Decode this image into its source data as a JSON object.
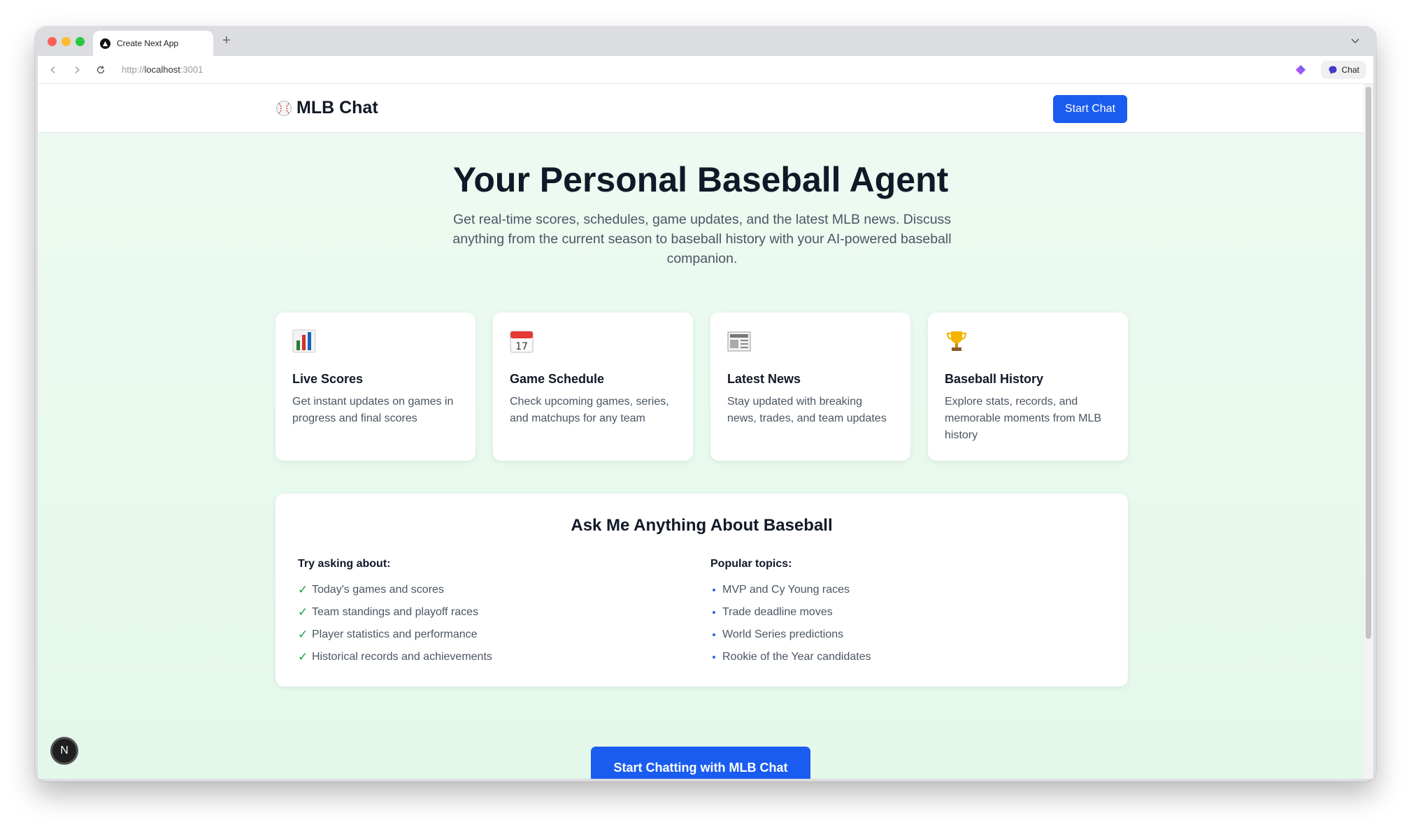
{
  "browser": {
    "tab_title": "Create Next App",
    "new_tab_symbol": "+",
    "url_scheme": "http://",
    "url_host": "localhost",
    "url_port": ":3001",
    "chat_button_label": "Chat"
  },
  "header": {
    "brand_name": "MLB Chat",
    "cta_label": "Start Chat"
  },
  "hero": {
    "title": "Your Personal Baseball Agent",
    "subtitle": "Get real-time scores, schedules, game updates, and the latest MLB news. Discuss anything from the current season to baseball history with your AI-powered baseball companion."
  },
  "features": [
    {
      "icon": "bar-chart-icon",
      "title": "Live Scores",
      "description": "Get instant updates on games in progress and final scores"
    },
    {
      "icon": "calendar-icon",
      "title": "Game Schedule",
      "description": "Check upcoming games, series, and matchups for any team",
      "icon_text": "17"
    },
    {
      "icon": "newspaper-icon",
      "title": "Latest News",
      "description": "Stay updated with breaking news, trades, and team updates"
    },
    {
      "icon": "trophy-icon",
      "title": "Baseball History",
      "description": "Explore stats, records, and memorable moments from MLB history"
    }
  ],
  "ask": {
    "title": "Ask Me Anything About Baseball",
    "left_title": "Try asking about:",
    "left_items": [
      "Today's games and scores",
      "Team standings and playoff races",
      "Player statistics and performance",
      "Historical records and achievements"
    ],
    "check_mark": "✓",
    "right_title": "Popular topics:",
    "right_items": [
      "MVP and Cy Young races",
      "Trade deadline moves",
      "World Series predictions",
      "Rookie of the Year candidates"
    ]
  },
  "main_cta_label": "Start Chatting with MLB Chat",
  "next_badge": "N",
  "colors": {
    "primary": "#1a5cf0",
    "check": "#16a34a",
    "background": "#e6f9ec"
  }
}
